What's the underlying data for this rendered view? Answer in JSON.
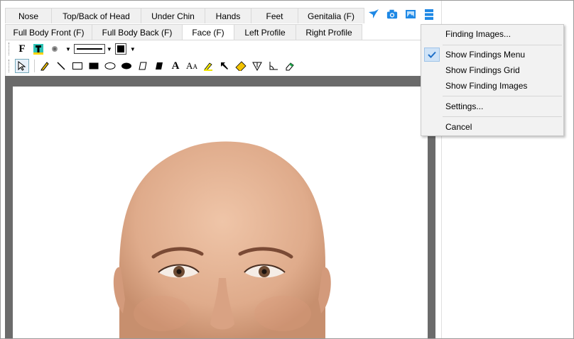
{
  "tabs": {
    "row1": [
      {
        "label": "Nose",
        "width": 66
      },
      {
        "label": "Top/Back of Head",
        "width": 127
      },
      {
        "label": "Under Chin",
        "width": 91
      },
      {
        "label": "Hands",
        "width": 66
      },
      {
        "label": "Feet",
        "width": 67
      },
      {
        "label": "Genitalia (F)",
        "width": 94
      }
    ],
    "row2": [
      {
        "label": "Full Body Front (F)",
        "width": 123
      },
      {
        "label": "Full Body Back (F)",
        "width": 128
      },
      {
        "label": "Face (F)",
        "width": 74,
        "active": true
      },
      {
        "label": "Left Profile",
        "width": 88
      },
      {
        "label": "Right Profile",
        "width": 94
      }
    ]
  },
  "top_icons": [
    "bird-icon",
    "camera-icon",
    "image-icon",
    "menu-icon"
  ],
  "toolbar": {
    "row1": [
      "font-bold-icon",
      "text-color-icon",
      "brush-size-icon",
      "line-style-select",
      "fill-color-select"
    ],
    "row2": [
      "pointer-tool",
      "pencil-tool",
      "line-tool",
      "rectangle-tool",
      "filled-rectangle-tool",
      "ellipse-tool",
      "filled-ellipse-tool",
      "polygon-tool",
      "filled-polygon-tool",
      "text-tool",
      "text-size-tool",
      "highlighter-tool",
      "arrow-tool",
      "ruler-tool",
      "protractor-tool",
      "angle-tool",
      "eraser-tool"
    ]
  },
  "menu": {
    "items": [
      {
        "label": "Finding Images...",
        "checked": false
      },
      {
        "label": "Show Findings Menu",
        "checked": true
      },
      {
        "label": "Show Findings Grid",
        "checked": false
      },
      {
        "label": "Show Finding Images",
        "checked": false
      },
      {
        "label": "Settings...",
        "checked": false
      },
      {
        "label": "Cancel",
        "checked": false
      }
    ]
  },
  "colors": {
    "accent": "#1e88e5",
    "canvas_bg": "#6b6b6b",
    "skin": "#e3b294"
  }
}
